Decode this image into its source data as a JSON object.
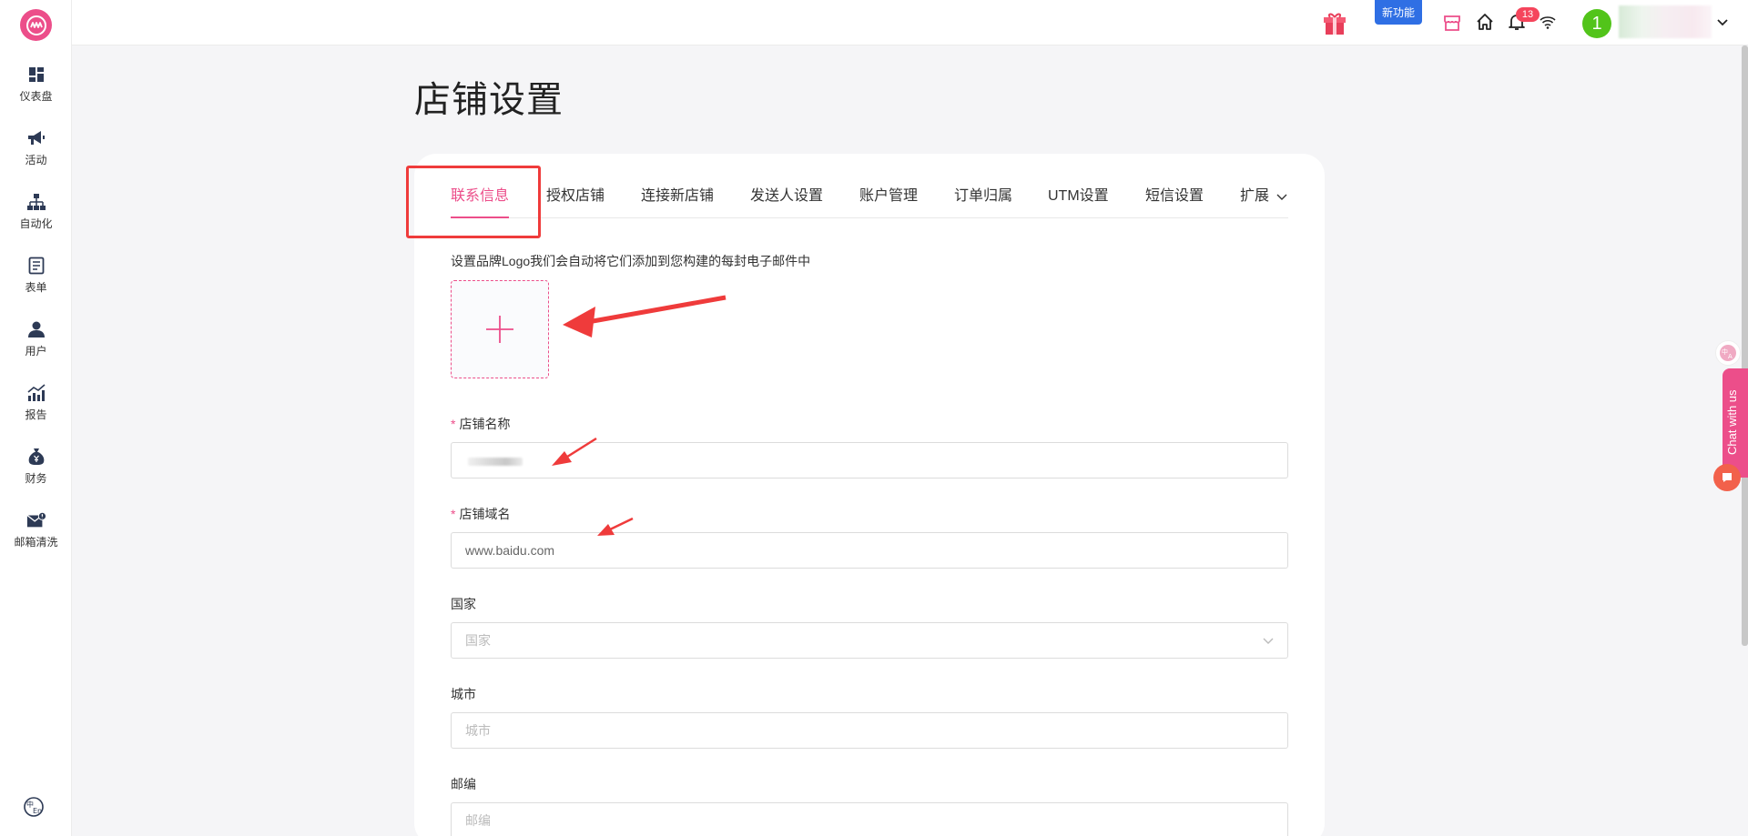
{
  "sidebar": {
    "items": [
      {
        "label": "仪表盘",
        "icon": "dashboard-icon"
      },
      {
        "label": "活动",
        "icon": "megaphone-icon"
      },
      {
        "label": "自动化",
        "icon": "hierarchy-icon"
      },
      {
        "label": "表单",
        "icon": "form-icon"
      },
      {
        "label": "用户",
        "icon": "user-icon"
      },
      {
        "label": "报告",
        "icon": "report-chart-icon"
      },
      {
        "label": "财务",
        "icon": "money-bag-icon"
      },
      {
        "label": "邮箱清洗",
        "icon": "mail-clean-icon"
      }
    ]
  },
  "topbar": {
    "new_feature": "新功能",
    "notification_count": "13",
    "avatar_initial": "1"
  },
  "page": {
    "title": "店铺设置"
  },
  "tabs": [
    {
      "label": "联系信息",
      "active": true
    },
    {
      "label": "授权店铺"
    },
    {
      "label": "连接新店铺"
    },
    {
      "label": "发送人设置"
    },
    {
      "label": "账户管理"
    },
    {
      "label": "订单归属"
    },
    {
      "label": "UTM设置"
    },
    {
      "label": "短信设置"
    },
    {
      "label": "扩展"
    }
  ],
  "form": {
    "logo_desc": "设置品牌Logo我们会自动将它们添加到您构建的每封电子邮件中",
    "store_name_label": "店铺名称",
    "store_domain_label": "店铺域名",
    "store_domain_value": "www.baidu.com",
    "country_label": "国家",
    "country_placeholder": "国家",
    "city_label": "城市",
    "city_placeholder": "城市",
    "zip_label": "邮编",
    "zip_placeholder": "邮编",
    "required_mark": "*"
  },
  "chat": {
    "label": "Chat with us"
  },
  "colors": {
    "accent": "#ec4e8a",
    "annotation": "#ef3b3b",
    "avatar": "#52c41a",
    "badge": "#f5455c",
    "new_feature": "#2f6fe4"
  }
}
